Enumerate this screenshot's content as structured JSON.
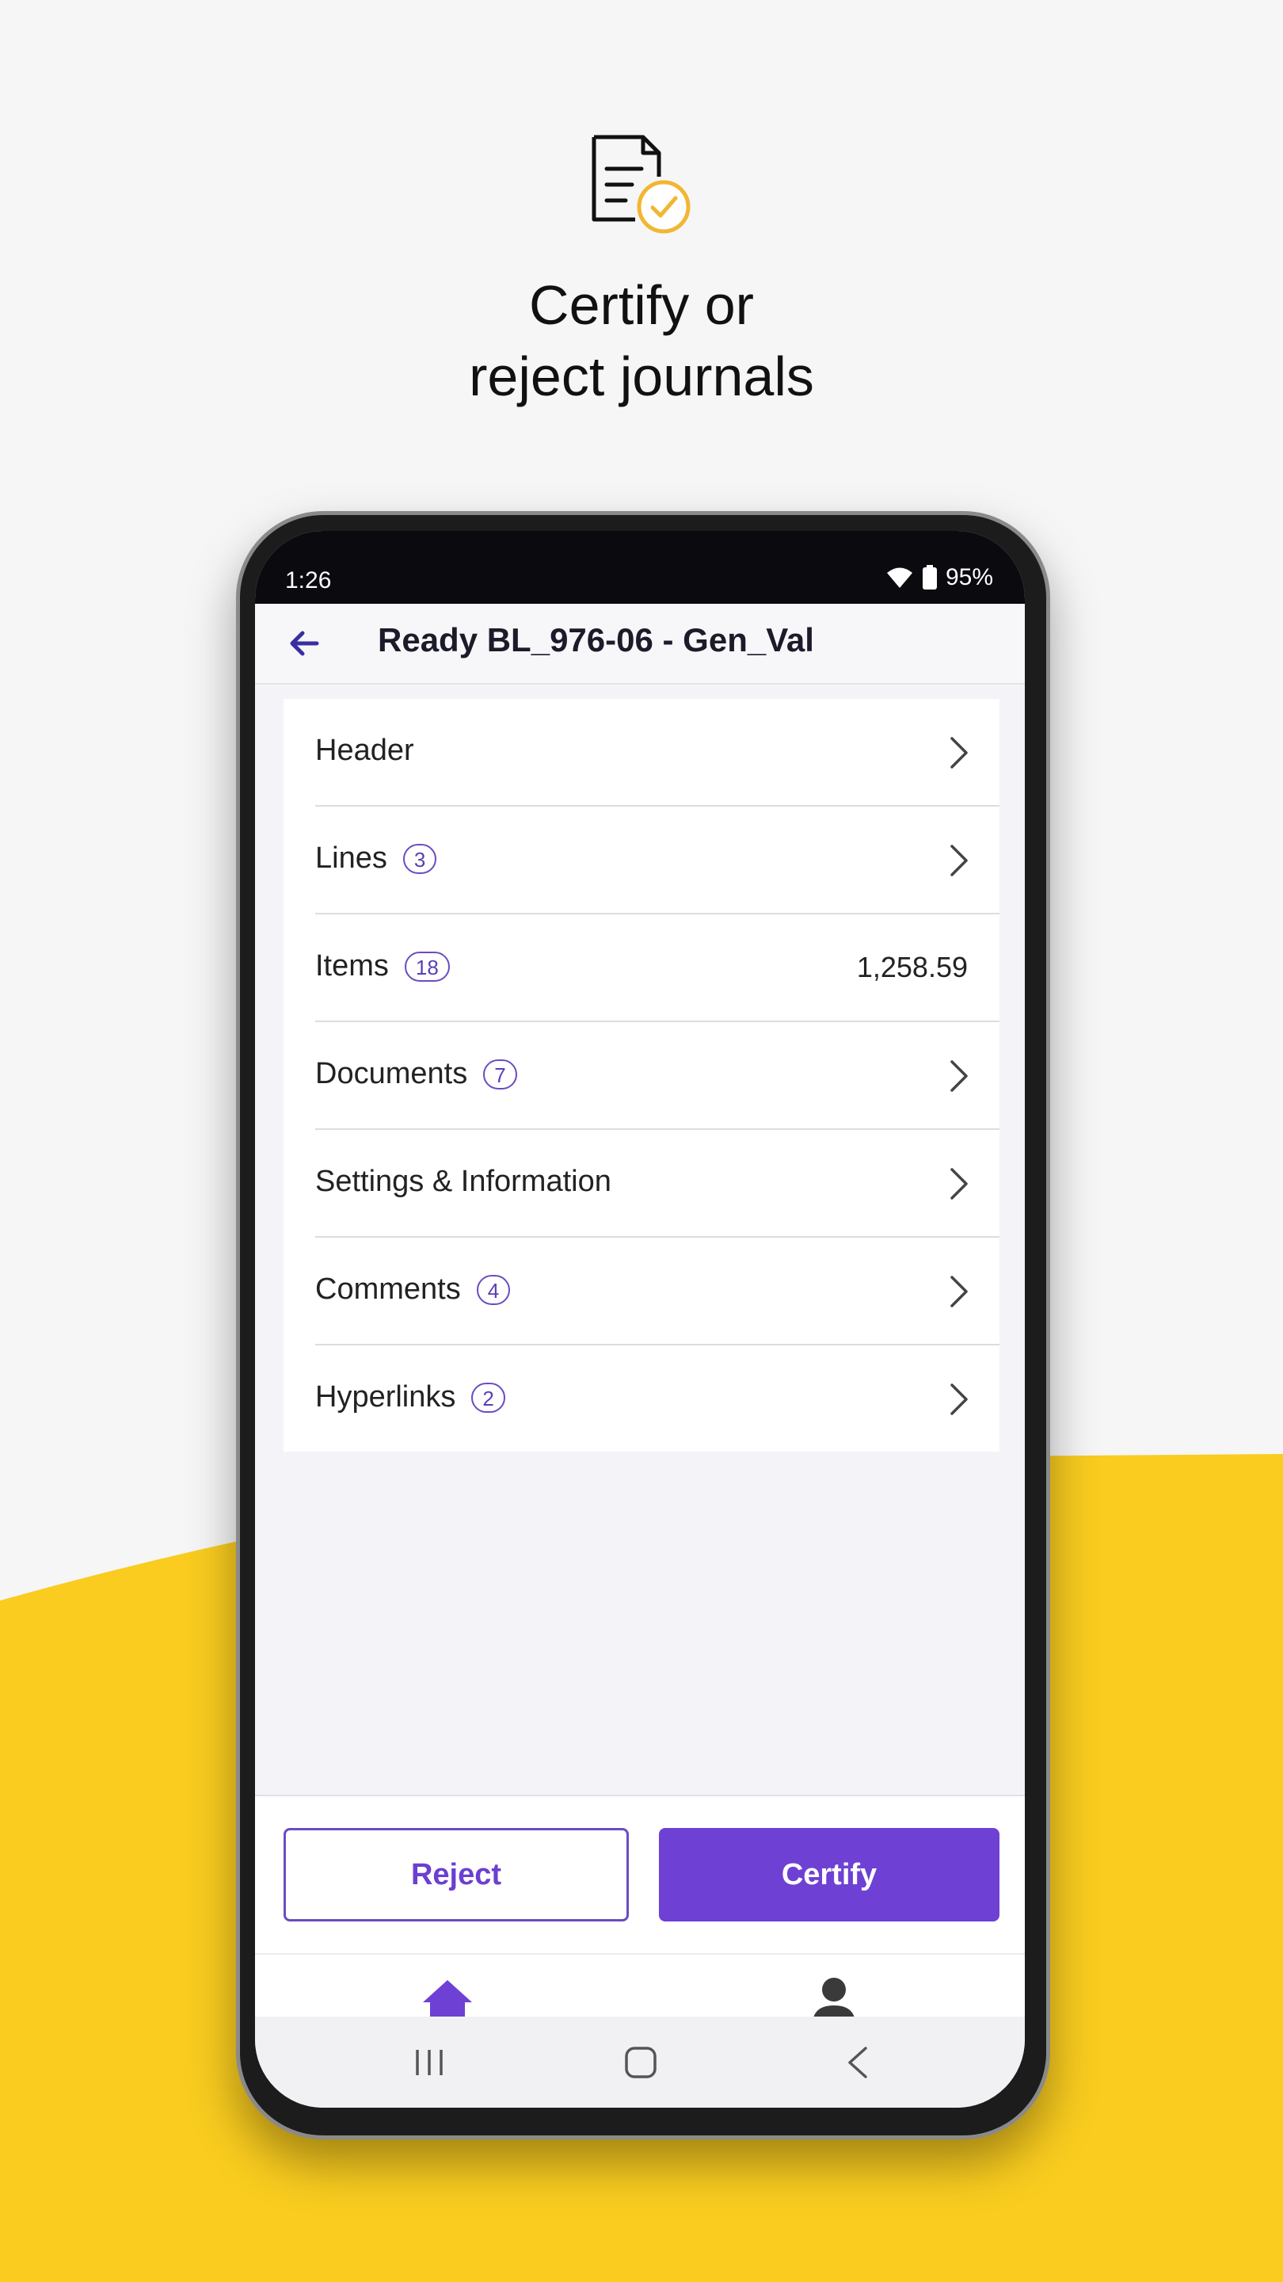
{
  "hero": {
    "title_line1": "Certify or",
    "title_line2": "reject journals"
  },
  "colors": {
    "accent": "#6e40d4",
    "yellow": "#f9cc1f",
    "check_orange": "#f2b632"
  },
  "status_bar": {
    "time": "1:26",
    "battery": "95%"
  },
  "app_bar": {
    "title": "Ready BL_976-06 - Gen_Val"
  },
  "rows": [
    {
      "label": "Header",
      "badge": null,
      "value": null,
      "chevron": true
    },
    {
      "label": "Lines",
      "badge": "3",
      "value": null,
      "chevron": true
    },
    {
      "label": "Items",
      "badge": "18",
      "value": "1,258.59",
      "chevron": false
    },
    {
      "label": "Documents",
      "badge": "7",
      "value": null,
      "chevron": true
    },
    {
      "label": "Settings & Information",
      "badge": null,
      "value": null,
      "chevron": true
    },
    {
      "label": "Comments",
      "badge": "4",
      "value": null,
      "chevron": true
    },
    {
      "label": "Hyperlinks",
      "badge": "2",
      "value": null,
      "chevron": true
    }
  ],
  "actions": {
    "reject": "Reject",
    "certify": "Certify"
  },
  "icons": {
    "hero": "document-check-icon",
    "back": "arrow-left-icon",
    "wifi": "wifi-icon",
    "battery": "battery-icon",
    "chevron": "chevron-right-icon",
    "home": "home-icon",
    "profile": "person-icon",
    "recent": "recent-apps-icon",
    "sys_home": "system-home-icon",
    "sys_back": "system-back-icon"
  }
}
